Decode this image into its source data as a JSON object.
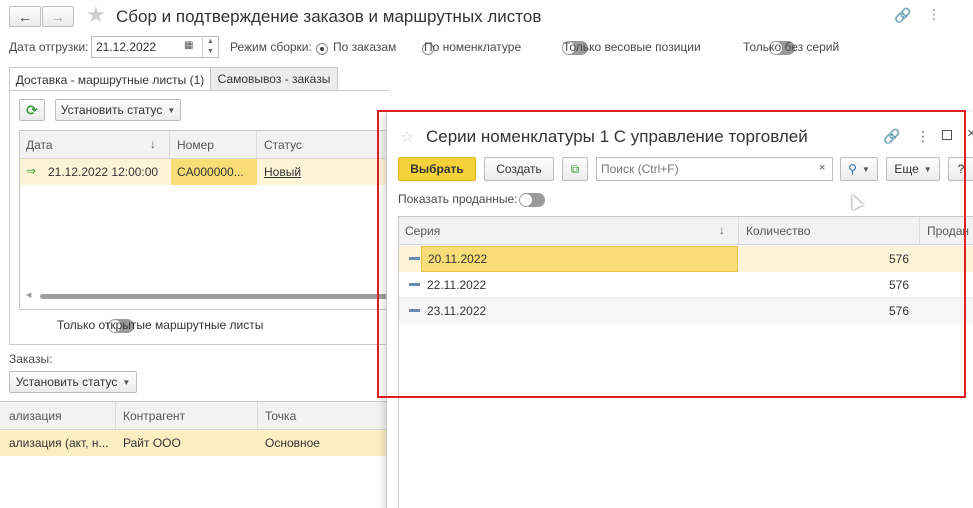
{
  "window": {
    "title": "Сбор и подтверждение заказов и маршрутных листов"
  },
  "filters": {
    "date_label": "Дата отгрузки:",
    "date_value": "21.12.2022",
    "mode_label": "Режим сборки:",
    "mode_options": [
      "По заказам",
      "По номенклатуре"
    ],
    "selected_mode": "По заказам",
    "toggle_weight": "Только весовые позиции",
    "toggle_noseries": "Только без серий"
  },
  "tabs": [
    "Доставка - маршрутные листы (1)",
    "Самовывоз - заказы"
  ],
  "routes": {
    "set_status_label": "Установить статус",
    "columns": [
      "Дата",
      "Номер",
      "Статус"
    ],
    "rows": [
      {
        "date": "21.12.2022 12:00:00",
        "number": "CA000000...",
        "status": "Новый"
      }
    ],
    "only_open_label": "Только открытые маршрутные листы"
  },
  "orders": {
    "section_label": "Заказы:",
    "set_status_label": "Установить статус",
    "columns": [
      "ализация",
      "Контрагент",
      "Точка"
    ],
    "rows": [
      {
        "doc": "ализация (акт, н...",
        "counterparty": "Райт ООО",
        "point": "Основное"
      }
    ]
  },
  "modal": {
    "title": "Серии номенклатуры 1 С управление торговлей",
    "select_label": "Выбрать",
    "create_label": "Создать",
    "search_placeholder": "Поиск (Ctrl+F)",
    "more_label": "Еще",
    "help_label": "?",
    "show_sold_label": "Показать проданные:",
    "columns": [
      "Серия",
      "Количество",
      "Продан"
    ],
    "rows": [
      {
        "series": "20.11.2022",
        "qty": "576"
      },
      {
        "series": "22.11.2022",
        "qty": "576"
      },
      {
        "series": "23.11.2022",
        "qty": "576"
      }
    ]
  },
  "colors": {
    "accent_yellow": "#f5d23a",
    "selection": "#fbeec2",
    "annotation_red": "#e02020",
    "refresh_green": "#3a9a3a"
  }
}
